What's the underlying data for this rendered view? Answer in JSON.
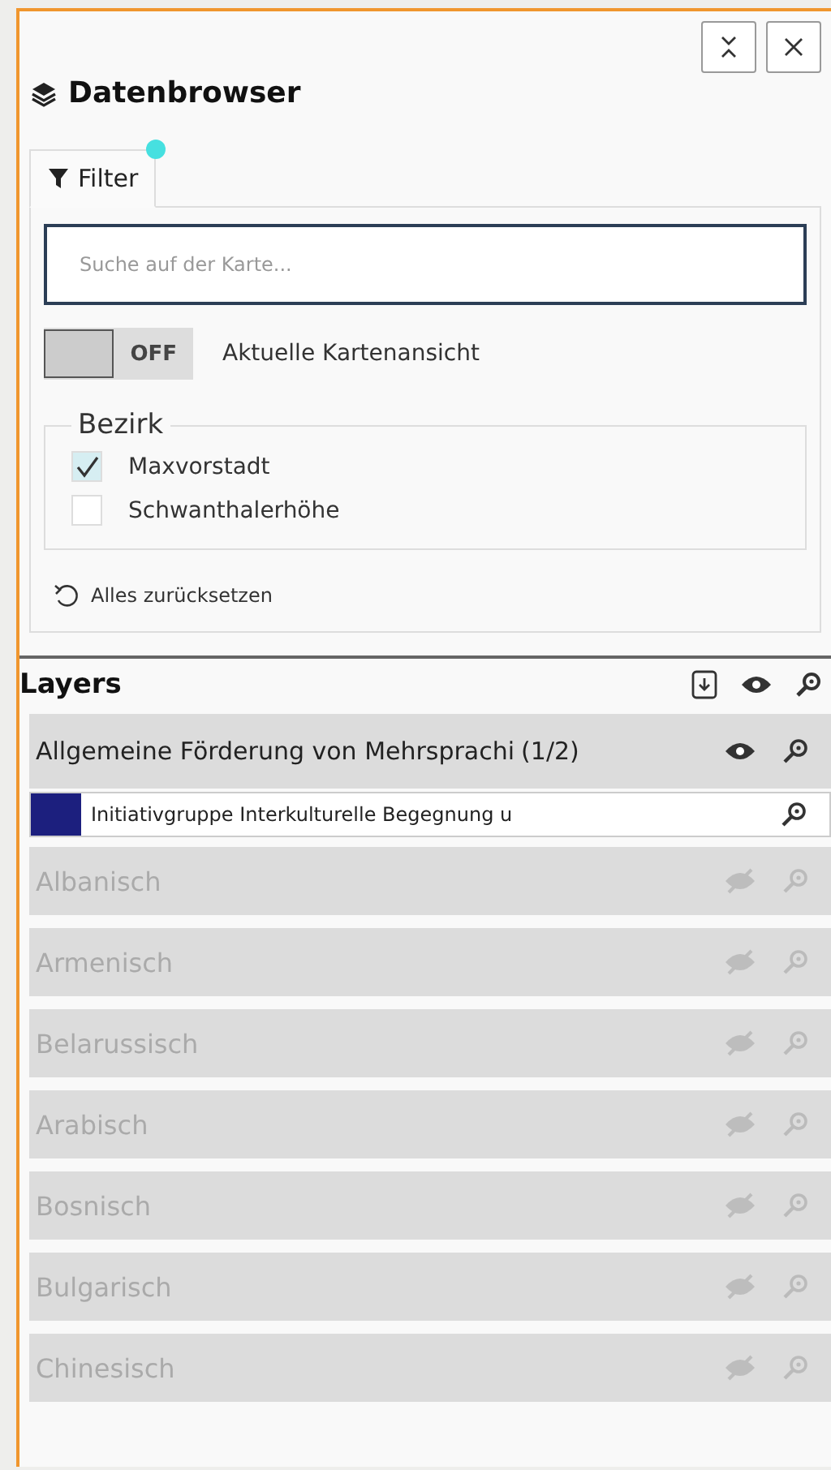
{
  "title": "Datenbrowser",
  "tabs": [
    {
      "label": "Filter",
      "selected": true,
      "has_indicator": true
    }
  ],
  "search": {
    "placeholder": "Suche auf der Karte..."
  },
  "map_view_toggle": {
    "on": false,
    "state_label": "OFF",
    "label": "Aktuelle Kartenansicht"
  },
  "district_group": {
    "legend": "Bezirk",
    "options": [
      {
        "label": "Maxvorstadt",
        "checked": true
      },
      {
        "label": "Schwanthalerhöhe",
        "checked": false
      }
    ]
  },
  "reset_link": "Alles zurücksetzen",
  "layers": {
    "title": "Layers",
    "items": [
      {
        "name": "Allgemeine Förderung von Mehrsprachi",
        "count": "(1/2)",
        "visible": true,
        "children": [
          {
            "name": "Initiativgruppe Interkulturelle Begegnung u",
            "color": "#1c1f7e"
          }
        ]
      },
      {
        "name": "Albanisch",
        "visible": false
      },
      {
        "name": "Armenisch",
        "visible": false
      },
      {
        "name": "Belarussisch",
        "visible": false
      },
      {
        "name": "Arabisch",
        "visible": false
      },
      {
        "name": "Bosnisch",
        "visible": false
      },
      {
        "name": "Bulgarisch",
        "visible": false
      },
      {
        "name": "Chinesisch",
        "visible": false
      }
    ]
  }
}
